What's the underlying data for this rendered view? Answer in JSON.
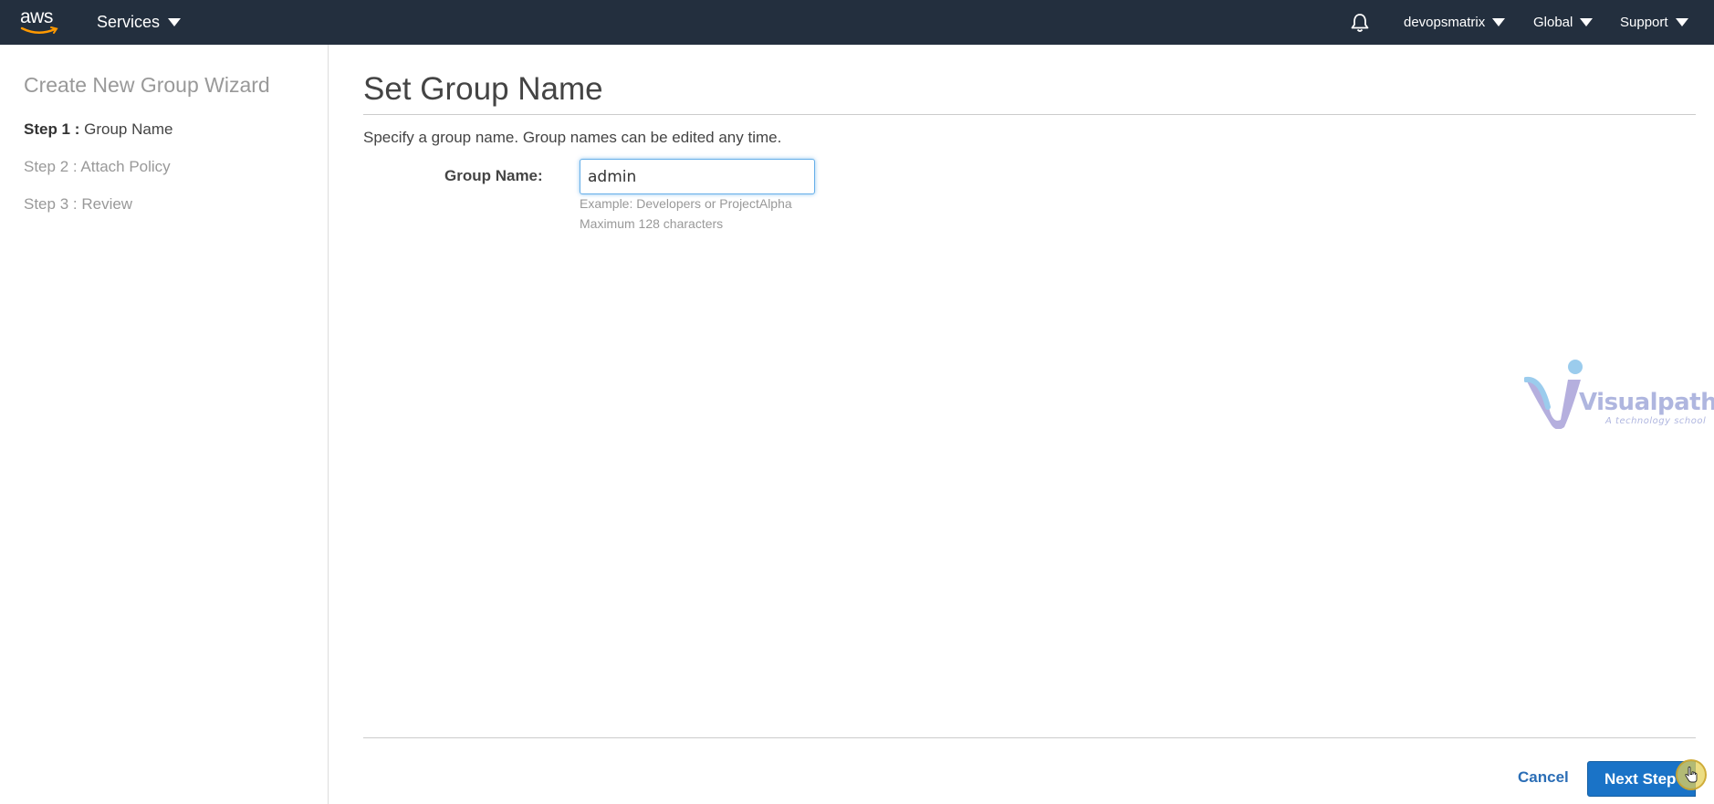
{
  "topnav": {
    "logo_text": "aws",
    "services_label": "Services",
    "bell_icon": "bell-icon",
    "account_label": "devopsmatrix",
    "region_label": "Global",
    "support_label": "Support",
    "background": "#232f3e"
  },
  "sidebar": {
    "title": "Create New Group Wizard",
    "steps": [
      {
        "num": "Step 1 :",
        "label": "Group Name",
        "active": true
      },
      {
        "num": "Step 2 :",
        "label": "Attach Policy",
        "active": false
      },
      {
        "num": "Step 3 :",
        "label": "Review",
        "active": false
      }
    ]
  },
  "main": {
    "title": "Set Group Name",
    "description": "Specify a group name. Group names can be edited any time.",
    "field_label": "Group Name:",
    "field_value": "admin",
    "hint_1": "Example: Developers or ProjectAlpha",
    "hint_2": "Maximum 128 characters"
  },
  "footer": {
    "cancel_label": "Cancel",
    "next_label": "Next Step",
    "accent": "#1a73c7"
  },
  "watermark": {
    "name": "Visualpath",
    "tagline": "A technology school"
  }
}
